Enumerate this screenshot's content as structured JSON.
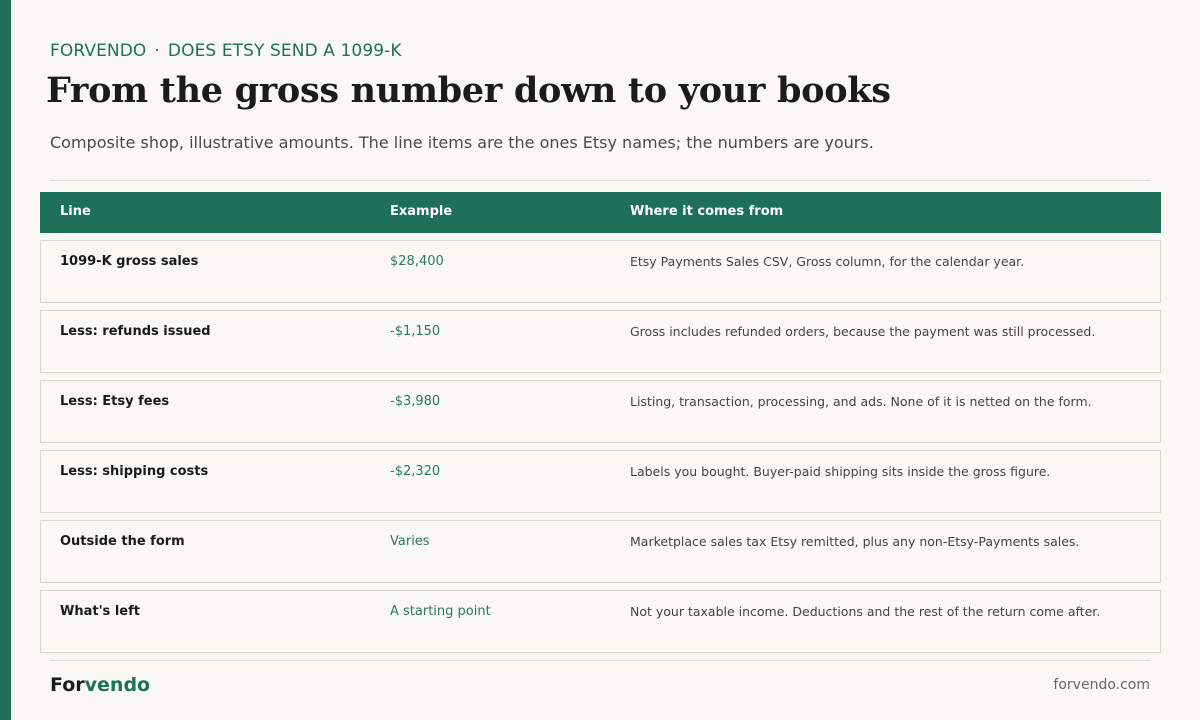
{
  "header": {
    "brand_label": "FORVENDO",
    "separator": "·",
    "section_label": "DOES ETSY SEND A 1099-K",
    "title": "From the gross number down to your books",
    "subtitle": "Composite shop, illustrative amounts. The line items are the ones Etsy names; the numbers are yours."
  },
  "table": {
    "columns": [
      "Line",
      "Example",
      "Where it comes from"
    ],
    "rows": [
      {
        "line": "1099-K gross sales",
        "example": "$28,400",
        "source": "Etsy Payments Sales CSV, Gross column, for the calendar year."
      },
      {
        "line": "Less: refunds issued",
        "example": "-$1,150",
        "source": "Gross includes refunded orders, because the payment was still processed."
      },
      {
        "line": "Less: Etsy fees",
        "example": "-$3,980",
        "source": "Listing, transaction, processing, and ads. None of it is netted on the form."
      },
      {
        "line": "Less: shipping costs",
        "example": "-$2,320",
        "source": "Labels you bought. Buyer-paid shipping sits inside the gross figure."
      },
      {
        "line": "Outside the form",
        "example": "Varies",
        "source": "Marketplace sales tax Etsy remitted, plus any non-Etsy-Payments sales."
      },
      {
        "line": "What's left",
        "example": "A starting point",
        "source": "Not your taxable income. Deductions and the rest of the return come after."
      }
    ]
  },
  "footer": {
    "logo_part1": "For",
    "logo_part2": "vendo",
    "site": "forvendo.com"
  },
  "colors": {
    "accent": "#1e7058",
    "background": "#f9f8f4",
    "text": "#1b1b1b"
  }
}
